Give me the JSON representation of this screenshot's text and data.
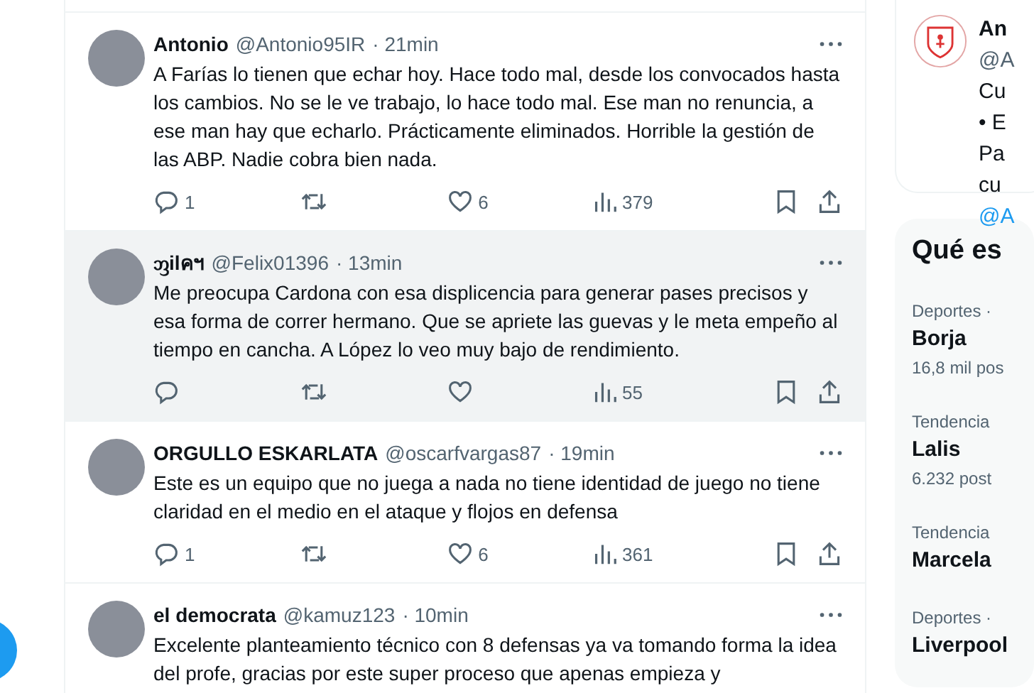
{
  "tweets": [
    {
      "name": "Antonio",
      "handle": "@Antonio95IR",
      "time": "· 21min",
      "hovered": false,
      "text": "A Farías lo tienen que echar hoy. Hace todo mal, desde los convocados hasta los cambios. No se le ve trabajo, lo hace todo mal. Ese man no renuncia, a ese man hay que echarlo. Prácticamente eliminados. Horrible la gestión de las ABP. Nadie cobra bien nada.",
      "replies": "1",
      "likes": "6",
      "views": "379"
    },
    {
      "name": "ᦀilคฯ",
      "handle": "@Felix01396",
      "time": "· 13min",
      "hovered": true,
      "text": "Me preocupa Cardona con esa displicencia para generar pases precisos y esa forma de correr hermano. Que se apriete las guevas y le meta empeño al tiempo en cancha. A López lo veo muy bajo de rendimiento.",
      "views": "55"
    },
    {
      "name": "ORGULLO ESKARLATA",
      "handle": "@oscarfvargas87",
      "time": "· 19min",
      "hovered": false,
      "text": "Este es un equipo que no juega a nada no tiene identidad de juego no tiene claridad en el medio en el ataque y flojos en defensa",
      "replies": "1",
      "likes": "6",
      "views": "361"
    },
    {
      "name": "el democrata",
      "handle": "@kamuz123",
      "time": "· 10min",
      "hovered": false,
      "text": "Excelente planteamiento técnico con 8 defensas  ya va tomando forma la idea del profe, gracias  por este super proceso  que apenas empieza y"
    }
  ],
  "side_card": {
    "name": "An",
    "handle": "@A",
    "lines": [
      "Cu",
      "• E",
      "Pa",
      "cu"
    ],
    "link": "@A"
  },
  "trends": {
    "title": "Qué es",
    "items": [
      {
        "context": "Deportes ·",
        "name": "Borja",
        "posts": "16,8 mil pos"
      },
      {
        "context": "Tendencia",
        "name": "Lalis",
        "posts": "6.232 post"
      },
      {
        "context": "Tendencia",
        "name": "Marcela"
      },
      {
        "context": "Deportes ·",
        "name": "Liverpool"
      }
    ]
  }
}
